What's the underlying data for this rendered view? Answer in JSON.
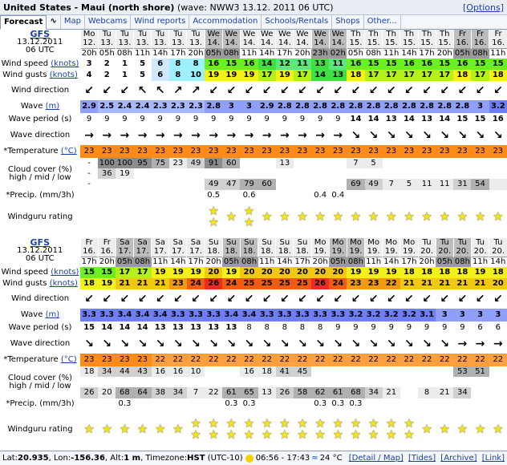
{
  "header": {
    "title": "United States - Maui (north shore)",
    "subtitle": "(wave: NWW3 13.12. 2011 06 UTC)",
    "options_label": "[Options]"
  },
  "tabs": [
    "Forecast",
    "Map",
    "Webcams",
    "Wind reports",
    "Accommodation",
    "Schools/Rentals",
    "Shops",
    "Other..."
  ],
  "footer": {
    "lat_label": "Lat: ",
    "lat": "20.935",
    "lon_label": ", Lon: ",
    "lon": "-156.36",
    "alt_label": ", Alt: ",
    "alt": "1 m",
    "tz_label": ", Timezone: ",
    "tz": "HST",
    "tz_offset": "(UTC-10)",
    "sun": "06:56 - 17:43",
    "temp": "24 °C",
    "links": [
      "[Detail / Map]",
      "[Tides]",
      "[Archive]",
      "[Link]"
    ]
  },
  "labels": {
    "model": "GFS",
    "date": "13.12.2011",
    "run": "06 UTC",
    "wind_speed": "Wind speed",
    "wind_gusts": "Wind gusts",
    "knots": "(knots)",
    "wind_dir": "Wind direction",
    "wave": "Wave",
    "m": "(m)",
    "wave_period": "Wave period (s)",
    "wave_dir": "Wave direction",
    "temperature": "*Temperature",
    "c": "(°C)",
    "cloud1": "Cloud cover (%)",
    "cloud2": "high / mid / low",
    "precip": "*Precip. (mm/3h)",
    "rating": "Windguru rating"
  },
  "blocks": [
    {
      "days": [
        "Mo",
        "Tu",
        "Tu",
        "Tu",
        "Tu",
        "Tu",
        "Tu",
        "We",
        "We",
        "We",
        "We",
        "We",
        "We",
        "We",
        "We",
        "Th",
        "Th",
        "Th",
        "Th",
        "Th",
        "Th",
        "Fr",
        "Fr",
        "Fr"
      ],
      "dates": [
        "12.",
        "13.",
        "13.",
        "13.",
        "13.",
        "13.",
        "13.",
        "14.",
        "14.",
        "14.",
        "14.",
        "14.",
        "14.",
        "14.",
        "14.",
        "15.",
        "15.",
        "15.",
        "15.",
        "15.",
        "15.",
        "16.",
        "16.",
        "16."
      ],
      "hours": [
        "20h",
        "05h",
        "08h",
        "11h",
        "14h",
        "17h",
        "20h",
        "05h",
        "08h",
        "11h",
        "14h",
        "17h",
        "20h",
        "23h",
        "02h",
        "05h",
        "08h",
        "11h",
        "14h",
        "17h",
        "20h",
        "05h",
        "08h",
        "11h"
      ],
      "dark": [
        false,
        false,
        false,
        false,
        false,
        false,
        false,
        true,
        true,
        false,
        false,
        false,
        false,
        true,
        true,
        false,
        false,
        false,
        false,
        false,
        false,
        true,
        true,
        false
      ],
      "wind_speed": [
        3,
        2,
        1,
        5,
        6,
        8,
        8,
        16,
        15,
        16,
        14,
        12,
        11,
        13,
        11,
        16,
        15,
        15,
        16,
        16,
        15,
        16,
        15,
        15
      ],
      "wind_gusts": [
        4,
        2,
        1,
        5,
        6,
        8,
        10,
        19,
        19,
        19,
        17,
        19,
        17,
        14,
        13,
        18,
        17,
        17,
        17,
        17,
        17,
        18,
        17,
        18
      ],
      "wind_dir": [
        "↙",
        "↙",
        "↙",
        "↖",
        "↖",
        "↗",
        "↗",
        "↙",
        "↙",
        "↙",
        "↙",
        "↙",
        "↙",
        "↙",
        "↙",
        "↙",
        "↙",
        "↙",
        "↙",
        "↙",
        "↙",
        "↙",
        "↙",
        "↙"
      ],
      "wave": [
        "2.9",
        "2.5",
        "2.4",
        "2.4",
        "2.3",
        "2.3",
        "2.3",
        "2.8",
        "3",
        "3",
        "2.9",
        "2.8",
        "2.8",
        "2.8",
        "2.8",
        "2.8",
        "2.8",
        "2.8",
        "2.8",
        "2.8",
        "2.8",
        "2.8",
        "3",
        "3.2"
      ],
      "wave_period": [
        9,
        9,
        9,
        9,
        9,
        9,
        9,
        9,
        9,
        9,
        9,
        9,
        9,
        9,
        9,
        14,
        14,
        13,
        14,
        13,
        14,
        15,
        15,
        16
      ],
      "wave_dir": [
        "→",
        "→",
        "→",
        "→",
        "→",
        "→",
        "→",
        "→",
        "→",
        "→",
        "→",
        "→",
        "→",
        "→",
        "→",
        "↘",
        "↘",
        "↘",
        "↘",
        "↘",
        "↘",
        "↘",
        "↘",
        "↘"
      ],
      "temperature": [
        23,
        23,
        23,
        23,
        23,
        23,
        23,
        23,
        23,
        23,
        23,
        23,
        23,
        23,
        23,
        23,
        23,
        23,
        23,
        23,
        23,
        23,
        23,
        23
      ],
      "cloud_high": [
        "-",
        "100",
        "100",
        "95",
        "75",
        "23",
        "49",
        "91",
        "60",
        "",
        "",
        "13",
        "",
        "",
        "",
        "7",
        "5",
        "",
        "",
        "",
        "",
        "",
        "",
        ""
      ],
      "cloud_mid": [
        "-",
        "36",
        "19",
        "",
        "",
        "",
        "",
        "",
        "",
        "",
        "",
        "",
        "",
        "",
        "",
        "",
        "",
        "",
        "",
        "",
        "",
        "",
        "",
        ""
      ],
      "cloud_low": [
        "-",
        "",
        "",
        "",
        "",
        "",
        "",
        "49",
        "47",
        "79",
        "60",
        "",
        "",
        "",
        "",
        "69",
        "49",
        "7",
        "5",
        "11",
        "11",
        "31",
        "54"
      ],
      "precip": [
        "",
        "",
        "",
        "",
        "",
        "",
        "",
        "0.5",
        "",
        "0.6",
        "",
        "",
        "",
        "0.4",
        "0.4",
        "",
        "",
        "",
        "",
        "",
        "",
        "",
        "",
        ""
      ],
      "rating": [
        0,
        0,
        0,
        0,
        0,
        0,
        0,
        2,
        1,
        2,
        1,
        1,
        1,
        1,
        1,
        1,
        1,
        1,
        1,
        1,
        1,
        1,
        1,
        1
      ]
    },
    {
      "days": [
        "Fr",
        "Fr",
        "Sa",
        "Sa",
        "Sa",
        "Sa",
        "Sa",
        "Su",
        "Su",
        "Su",
        "Su",
        "Su",
        "Su",
        "Mo",
        "Mo",
        "Mo",
        "Mo",
        "Mo",
        "Mo",
        "Tu",
        "Tu",
        "Tu",
        "Tu",
        "Tu"
      ],
      "dates": [
        "16.",
        "16.",
        "17.",
        "17.",
        "17.",
        "17.",
        "17.",
        "18.",
        "18.",
        "18.",
        "18.",
        "18.",
        "18.",
        "19.",
        "19.",
        "19.",
        "19.",
        "19.",
        "19.",
        "20.",
        "20.",
        "20.",
        "20.",
        "20."
      ],
      "hours": [
        "17h",
        "20h",
        "05h",
        "08h",
        "11h",
        "14h",
        "17h",
        "20h",
        "05h",
        "08h",
        "11h",
        "14h",
        "17h",
        "20h",
        "05h",
        "08h",
        "11h",
        "14h",
        "17h",
        "20h",
        "05h",
        "08h",
        "11h",
        "14h"
      ],
      "dark": [
        false,
        false,
        true,
        true,
        false,
        false,
        false,
        false,
        true,
        true,
        false,
        false,
        false,
        false,
        true,
        true,
        false,
        false,
        false,
        false,
        true,
        true,
        false,
        false
      ],
      "wind_speed": [
        15,
        15,
        17,
        17,
        19,
        19,
        19,
        20,
        19,
        20,
        20,
        20,
        20,
        20,
        20,
        19,
        19,
        19,
        18,
        18,
        18,
        18,
        19,
        18
      ],
      "wind_gusts": [
        18,
        19,
        21,
        21,
        21,
        23,
        24,
        26,
        24,
        25,
        25,
        25,
        25,
        26,
        24,
        23,
        23,
        22,
        21,
        21,
        21,
        21,
        21,
        20
      ],
      "wind_dir": [
        "↙",
        "↙",
        "↙",
        "↙",
        "↙",
        "↙",
        "↙",
        "↙",
        "↙",
        "↙",
        "↙",
        "↙",
        "↙",
        "↙",
        "↙",
        "↙",
        "↙",
        "↙",
        "↙",
        "↙",
        "↙",
        "↙",
        "↙",
        "↙"
      ],
      "wave": [
        "3.3",
        "3.3",
        "3.4",
        "3.4",
        "3.4",
        "3.3",
        "3.3",
        "3.3",
        "3.4",
        "3.4",
        "3.3",
        "3.3",
        "3.3",
        "3.3",
        "3.3",
        "3.2",
        "3.2",
        "3.2",
        "3.2",
        "3.1",
        "3",
        "3",
        "3",
        "3"
      ],
      "wave_period": [
        15,
        14,
        14,
        14,
        13,
        13,
        13,
        13,
        13,
        8,
        8,
        8,
        8,
        8,
        9,
        9,
        9,
        9,
        9,
        9,
        9,
        9,
        6,
        6
      ],
      "wave_dir": [
        "↘",
        "↘",
        "↘",
        "↘",
        "↘",
        "↘",
        "↘",
        "↘",
        "↘",
        "↘",
        "↘",
        "↘",
        "↘",
        "↘",
        "↘",
        "↘",
        "↘",
        "↘",
        "↘",
        "↘",
        "↘",
        "→",
        "→",
        "→"
      ],
      "temperature": [
        23,
        23,
        23,
        23,
        22,
        22,
        22,
        22,
        22,
        22,
        22,
        22,
        22,
        22,
        22,
        22,
        22,
        22,
        22,
        22,
        22,
        22,
        22,
        22
      ],
      "cloud_high": [
        "18",
        "34",
        "44",
        "43",
        "16",
        "16",
        "10",
        "",
        "",
        "16",
        "18",
        "41",
        "45",
        "",
        "",
        "",
        "",
        "",
        "",
        "",
        "",
        "53",
        "51",
        ""
      ],
      "cloud_mid": [
        "",
        "",
        "",
        "",
        "",
        "",
        "",
        "",
        "",
        "",
        "",
        "",
        "",
        "",
        "",
        "",
        "",
        "",
        "",
        "",
        "",
        "",
        "",
        ""
      ],
      "cloud_low": [
        "26",
        "20",
        "68",
        "64",
        "38",
        "34",
        "7",
        "22",
        "61",
        "65",
        "13",
        "26",
        "58",
        "62",
        "61",
        "68",
        "34",
        "21",
        "",
        "8",
        "21",
        "34",
        "",
        ""
      ],
      "precip": [
        "",
        "",
        "0.3",
        "",
        "",
        "",
        "",
        "",
        "0.3",
        "0.3",
        "",
        "",
        "",
        "0.3",
        "0.3",
        "0.3",
        "",
        "",
        "",
        "",
        "",
        "",
        "",
        ""
      ],
      "rating": [
        1,
        1,
        1,
        1,
        1,
        1,
        2,
        2,
        2,
        2,
        2,
        2,
        2,
        2,
        2,
        2,
        2,
        2,
        2,
        1,
        1,
        1,
        1,
        1
      ]
    }
  ],
  "colors": {
    "grey_header": "#eeeeee",
    "dark_header": "#bdbdbd",
    "link": "#1a3fa8"
  }
}
